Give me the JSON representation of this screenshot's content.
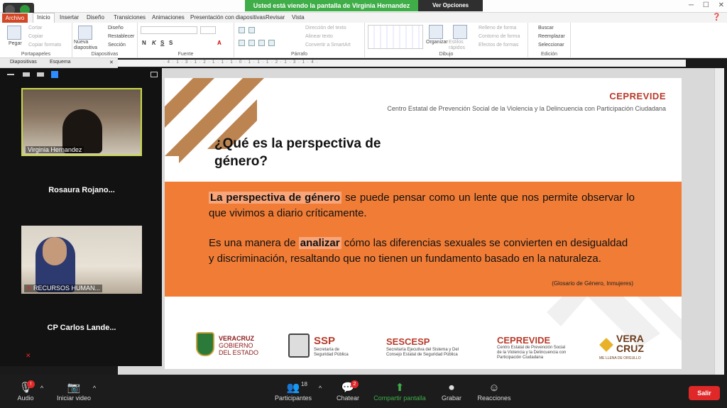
{
  "zoom": {
    "share_banner": "Usted está viendo la pantalla de Virginia Hernandez",
    "view_options": "Ver Opciones",
    "toolbar": {
      "audio": "Audio",
      "video": "Iniciar video",
      "participants": "Participantes",
      "participants_count": "18",
      "chat": "Chatear",
      "chat_badge": "2",
      "share": "Compartir pantalla",
      "record": "Grabar",
      "reactions": "Reacciones",
      "exit": "Salir"
    },
    "participants": [
      {
        "name": "Virginia Hernandez",
        "video": true
      },
      {
        "name": "Rosaura  Rojano...",
        "video": false
      },
      {
        "name": "RECURSOS HUMAN...",
        "video": true
      },
      {
        "name": "CP  Carlos  Lande...",
        "video": false
      }
    ]
  },
  "ppt": {
    "file_tab": "Archivo",
    "tabs": [
      "Inicio",
      "Insertar",
      "Diseño",
      "Transiciones",
      "Animaciones",
      "Presentación con diapositivas",
      "Revisar",
      "Vista"
    ],
    "groups": {
      "portapapeles": {
        "label": "Portapapeles",
        "paste": "Pegar",
        "cut": "Cortar",
        "copy": "Copiar",
        "format": "Copiar formato"
      },
      "diapositivas": {
        "label": "Diapositivas",
        "new": "Nueva diapositiva",
        "design": "Diseño",
        "reset": "Restablecer",
        "section": "Sección"
      },
      "fuente": {
        "label": "Fuente"
      },
      "parrafo": {
        "label": "Párrafo",
        "dir": "Dirección del texto",
        "align": "Alinear texto",
        "smartart": "Convertir a SmartArt"
      },
      "dibujo": {
        "label": "Dibujo",
        "arrange": "Organizar",
        "styles": "Estilos rápidos",
        "fill": "Relleno de forma",
        "outline": "Contorno de forma",
        "effects": "Efectos de formas"
      },
      "edicion": {
        "label": "Edición",
        "find": "Buscar",
        "replace": "Reemplazar",
        "select": "Seleccionar"
      }
    },
    "panel_tabs": {
      "slides": "Diapositivas",
      "outline": "Esquema"
    },
    "ruler": "· 4 · 1 · 3 · 1 · 2 · 1 · 1 · 1 · 0 · 1 · 1 · 1 · 2 · 1 · 3 · 1 · 4 ·"
  },
  "slide": {
    "org_name": "CEPREVIDE",
    "org_full": "Centro Estatal de Prevención Social de la Violencia y la Delincuencia con Participación Ciudadana",
    "title": "¿Qué es la perspectiva de género?",
    "para1_strong": "La perspectiva de género",
    "para1_rest": " se puede pensar como un lente que nos permite observar lo que vivimos a diario críticamente.",
    "para2_a": "Es una manera de ",
    "para2_strong": "analizar",
    "para2_b": " cómo las  diferencias sexuales se convierten en desigualdad y discriminación, resaltando que no tienen un fundamento basado en la naturaleza.",
    "citation": "(Glosario de Género, Inmujeres)",
    "logos": {
      "veracruz": [
        "VERACRUZ",
        "GOBIERNO",
        "DEL ESTADO"
      ],
      "ssp": {
        "title": "SSP",
        "sub": [
          "Secretaría de",
          "Seguridad Pública"
        ]
      },
      "sescesp": {
        "title": "SESCESP",
        "sub": [
          "Secretaría Ejecutiva del Sistema y Del",
          "Consejo Estatal de Seguridad Pública"
        ]
      },
      "ceprevide": {
        "title": "CEPREVIDE",
        "sub": [
          "Centro Estatal de Prevención Social",
          "de la Violencia y la Delincuencia con",
          "Participación Ciudadana"
        ]
      },
      "vera": {
        "title1": "VERA",
        "title2": "CRUZ",
        "sub": "ME LLENA DE ORGULLO"
      }
    }
  },
  "colors": {
    "orange": "#f07c36",
    "red": "#b83a2a",
    "green": "#3fad48"
  }
}
